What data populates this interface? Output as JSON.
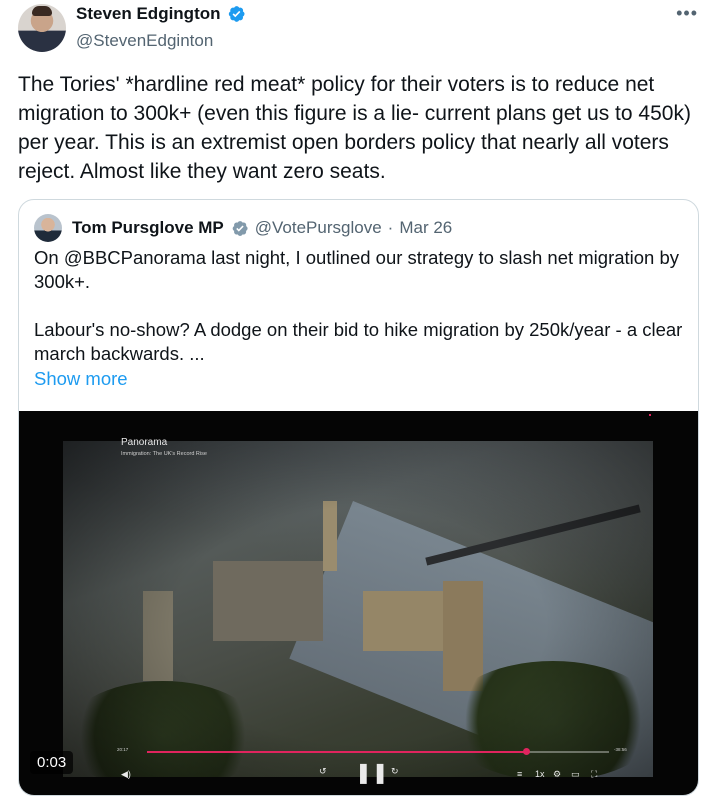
{
  "author": {
    "name": "Steven Edgington",
    "handle": "@StevenEdginton",
    "verified_color": "#1d9bf0"
  },
  "more_icon": "more-horizontal-icon",
  "tweet": {
    "text": "The Tories' *hardline red meat* policy for their voters is to reduce net migration to 300k+ (even this figure is a lie- current plans get us to 450k) per year. This is an extremist open borders policy that nearly all voters reject. Almost like they want zero seats."
  },
  "quote": {
    "name": "Tom Pursglove MP",
    "handle": "@VotePursglove",
    "separator": "·",
    "date": "Mar 26",
    "verified_color": "#829aab",
    "paragraph1": "On @BBCPanorama last night, I outlined our strategy to slash net migration by 300k+.",
    "paragraph2": "Labour's no-show? A dodge on their bid to hike migration by 250k/year - a clear march backwards. ...",
    "show_more": "Show more"
  },
  "video": {
    "channel": "Panorama",
    "subtitle": "Immigration: The UK's Record Rise",
    "elapsed_label": "20:17",
    "remaining_label": "-38:56",
    "timestamp": "0:03",
    "progress_fraction": 0.82,
    "accent_color": "#e0245e",
    "controls": [
      "volume-icon",
      "rewind-10-icon",
      "pause-icon",
      "forward-10-icon",
      "captions-icon",
      "speed-1x-icon",
      "settings-icon",
      "pip-icon",
      "fullscreen-icon"
    ]
  }
}
